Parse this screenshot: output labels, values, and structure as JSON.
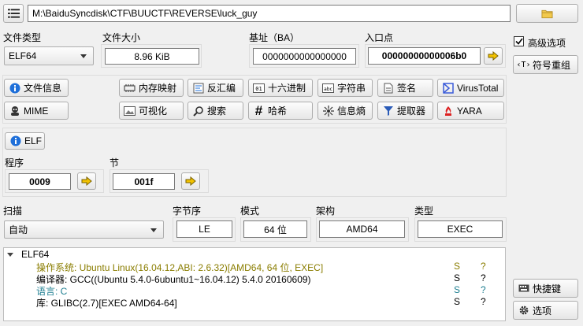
{
  "toolbar": {
    "path": "M:\\BaiduSyncdisk\\CTF\\BUUCTF\\REVERSE\\luck_guy",
    "menu_icon": "hamburger-menu-icon",
    "open_icon": "folder-icon"
  },
  "fileinfo": {
    "type_label": "文件类型",
    "type_value": "ELF64",
    "size_label": "文件大小",
    "size_value": "8.96 KiB",
    "base_label": "基址（BA）",
    "base_value": "0000000000000000",
    "entry_label": "入口点",
    "entry_value": "00000000000006b0"
  },
  "tools": [
    {
      "label": "文件信息",
      "icon": "info-icon"
    },
    {
      "label": "内存映射",
      "icon": "memory-map-icon"
    },
    {
      "label": "反汇编",
      "icon": "disassembly-icon"
    },
    {
      "label": "十六进制",
      "icon": "hex-icon"
    },
    {
      "label": "字符串",
      "icon": "strings-icon"
    },
    {
      "label": "签名",
      "icon": "signature-icon"
    },
    {
      "label": "VirusTotal",
      "icon": "virustotal-icon"
    },
    {
      "label": "MIME",
      "icon": "mime-icon"
    },
    {
      "label": "可视化",
      "icon": "image-icon"
    },
    {
      "label": "搜索",
      "icon": "search-icon"
    },
    {
      "label": "哈希",
      "icon": "hash-icon"
    },
    {
      "label": "信息熵",
      "icon": "entropy-icon"
    },
    {
      "label": "提取器",
      "icon": "extractor-icon"
    },
    {
      "label": "YARA",
      "icon": "yara-icon"
    }
  ],
  "elf": {
    "button_label": "ELF",
    "programs_label": "程序",
    "programs_value": "0009",
    "sections_label": "节",
    "sections_value": "001f"
  },
  "scan": {
    "scan_label": "扫描",
    "scan_value": "自动",
    "endian_label": "字节序",
    "endian_value": "LE",
    "mode_label": "模式",
    "mode_value": "64 位",
    "arch_label": "架构",
    "arch_value": "AMD64",
    "type_label": "类型",
    "type_value": "EXEC"
  },
  "results": {
    "root": "ELF64",
    "rows": [
      {
        "text": "操作系统: Ubuntu Linux(16.04.12,ABI: 2.6.32)[AMD64, 64 位, EXEC]",
        "s": "S",
        "q": "?",
        "color": "olive"
      },
      {
        "text": "编译器: GCC((Ubuntu 5.4.0-6ubuntu1~16.04.12) 5.4.0 20160609)",
        "s": "S",
        "q": "?",
        "color": "black"
      },
      {
        "text": "语言: C",
        "s": "S",
        "q": "?",
        "color": "teal"
      },
      {
        "text": "库: GLIBC(2.7)[EXEC AMD64-64]",
        "s": "S",
        "q": "?",
        "color": "black"
      }
    ]
  },
  "side": {
    "advanced_label": "高级选项",
    "advanced_checked": true,
    "symbol_label": "符号重组",
    "shortcuts_label": "快捷键",
    "options_label": "选项"
  }
}
